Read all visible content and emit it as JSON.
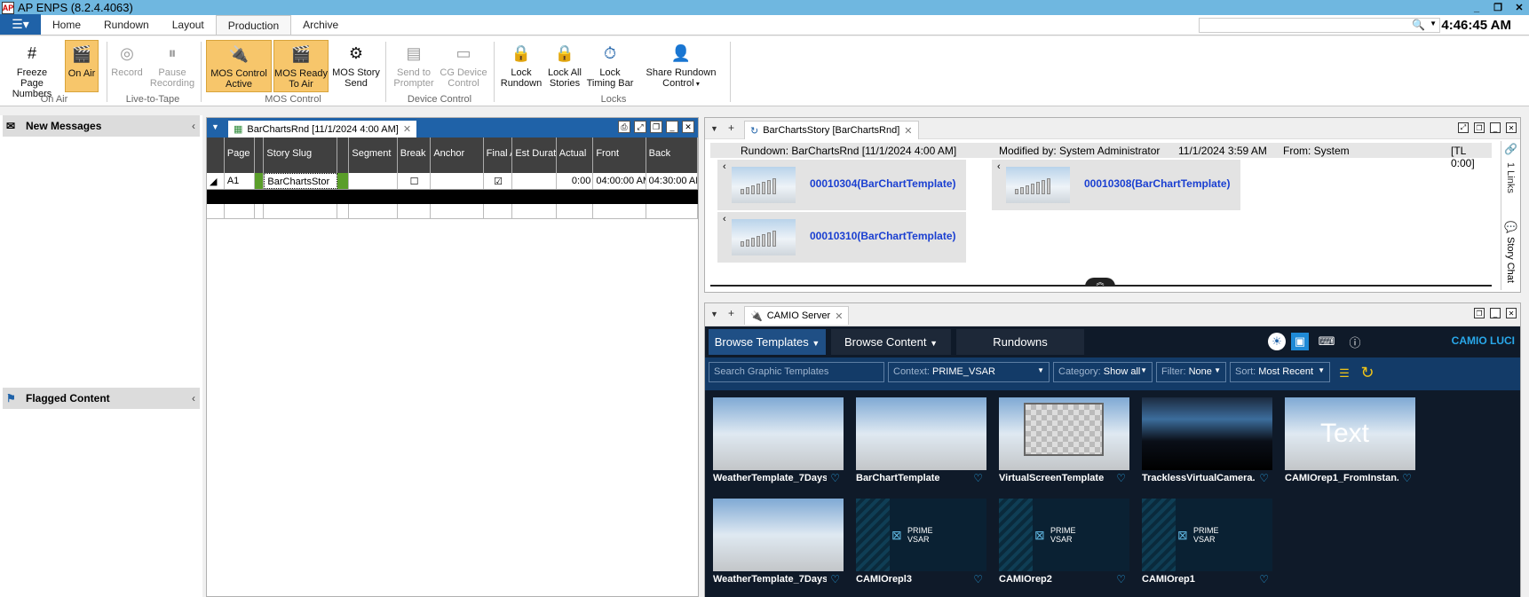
{
  "app": {
    "title": "AP ENPS (8.2.4.4063)",
    "logo": "AP",
    "clock": "4:46:45 AM"
  },
  "tabs": [
    "Home",
    "Rundown",
    "Layout",
    "Production",
    "Archive"
  ],
  "ribbon": {
    "freeze": "Freeze Page Numbers",
    "on_air": "On Air",
    "group_on_air": "On Air",
    "record": "Record",
    "pause": "Pause Recording",
    "group_ltt": "Live-to-Tape",
    "mos_active": "MOS Control Active",
    "mos_ready": "MOS Ready To Air",
    "mos_send": "MOS Story Send",
    "group_mos": "MOS Control",
    "send_prompter": "Send to Prompter",
    "cg_device": "CG Device Control",
    "group_device": "Device Control",
    "lock_rundown": "Lock Rundown",
    "lock_all": "Lock All Stories",
    "lock_timing": "Lock Timing Bar",
    "share": "Share Rundown Control",
    "group_locks": "Locks"
  },
  "left": {
    "new_messages": "New Messages",
    "flagged": "Flagged Content"
  },
  "rundown": {
    "tab": "BarChartsRnd [11/1/2024 4:00 AM]",
    "columns": [
      "Page",
      "Story Slug",
      "Segment",
      "Break",
      "Anchor",
      "Final A",
      "Est Durat",
      "Actual",
      "Front",
      "Back"
    ],
    "row": {
      "page": "A1",
      "slug": "BarChartsStor",
      "actual": "0:00",
      "front": "04:00:00 AM",
      "back": "04:30:00 AM"
    }
  },
  "story": {
    "tab": "BarChartsStory [BarChartsRnd]",
    "rundown": "Rundown: BarChartsRnd [11/1/2024 4:00 AM]",
    "modified": "Modified by: System Administrator",
    "date": "11/1/2024 3:59 AM",
    "from": "From: System",
    "tl": "[TL 0:00]",
    "items": [
      "00010304(BarChartTemplate)",
      "00010308(BarChartTemplate)",
      "00010310(BarChartTemplate)"
    ],
    "links": "1 Links",
    "chat": "Story Chat"
  },
  "camio": {
    "tab": "CAMIO Server",
    "browse_templates": "Browse Templates",
    "browse_content": "Browse Content",
    "rundowns": "Rundowns",
    "logo": "CAMIO LUCI",
    "search_placeholder": "Search Graphic Templates",
    "context_label": "Context:",
    "context_value": "PRIME_VSAR",
    "category_label": "Category:",
    "category_value": "Show all",
    "filter_label": "Filter:",
    "filter_value": "None",
    "sort_label": "Sort:",
    "sort_value": "Most Recent",
    "templates": [
      "WeatherTemplate_7Days",
      "BarChartTemplate",
      "VirtualScreenTemplate",
      "TracklessVirtualCamera...",
      "CAMIOrep1_FromInstan...",
      "WeatherTemplate_7Days",
      "CAMIOrepl3",
      "CAMIOrep2",
      "CAMIOrep1"
    ],
    "prime_line1": "PRIME",
    "prime_line2": "VSAR",
    "text_overlay": "Text"
  }
}
